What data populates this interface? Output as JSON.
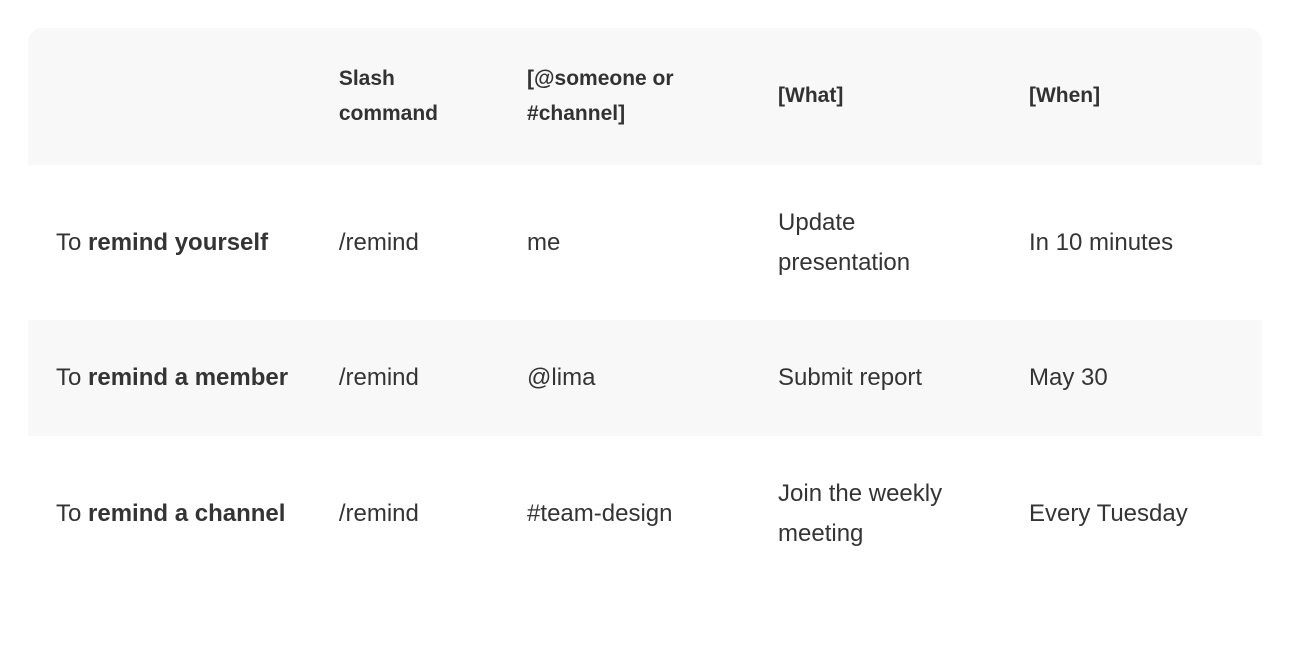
{
  "table": {
    "headers": {
      "col0": "",
      "col1": "Slash command",
      "col2": "[@someone or #channel]",
      "col3": "[What]",
      "col4": "[When]"
    },
    "rows": [
      {
        "label_prefix": "To ",
        "label_bold": "remind yourself",
        "slash_command": "/remind",
        "target": "me",
        "what": "Update presentation",
        "when": "In 10 minutes"
      },
      {
        "label_prefix": "To ",
        "label_bold": "remind a member",
        "slash_command": "/remind",
        "target": "@lima",
        "what": "Submit report",
        "when": "May 30"
      },
      {
        "label_prefix": "To ",
        "label_bold": "remind a channel",
        "slash_command": "/remind",
        "target": "#team-design",
        "what": "Join the weekly meeting",
        "when": "Every Tuesday"
      }
    ]
  }
}
